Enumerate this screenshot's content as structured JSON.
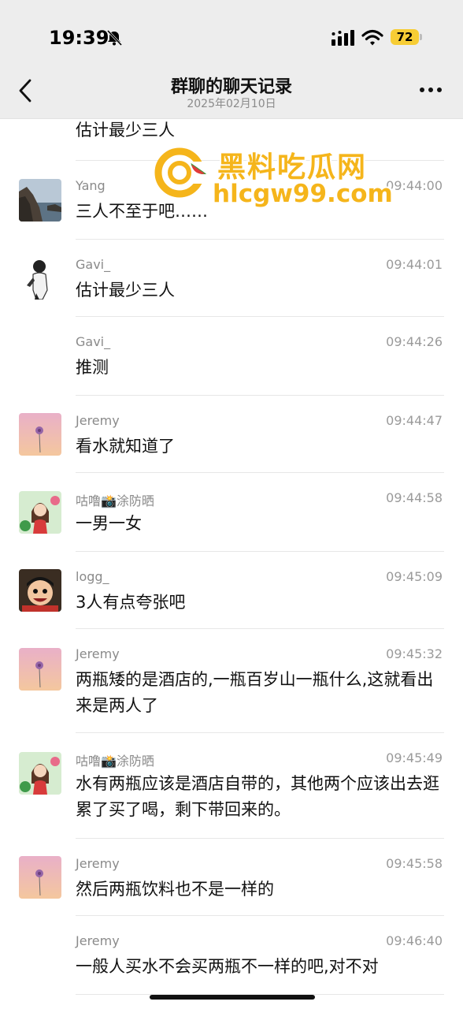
{
  "status_bar": {
    "time": "19:39",
    "battery": "72",
    "muted": true
  },
  "header": {
    "title": "群聊的聊天记录",
    "date": "2025年02月10日",
    "back_icon": "chevron-left-icon",
    "more_icon": "ellipsis-icon"
  },
  "watermark": {
    "title": "黑料吃瓜网",
    "url": "hlcgw99.com",
    "color": "#f5b51b"
  },
  "messages": [
    {
      "text": "估计最少三人"
    },
    {
      "sender": "Yang",
      "time": "09:44:00",
      "text": "三人不至于吧……",
      "avatar": "landscape-avatar"
    },
    {
      "sender": "Gavi_",
      "time": "09:44:01",
      "text": "估计最少三人",
      "avatar": "person-avatar"
    },
    {
      "sender": "Gavi_",
      "time": "09:44:26",
      "text": "推测"
    },
    {
      "sender": "Jeremy",
      "time": "09:44:47",
      "text": "看水就知道了",
      "avatar": "flower-avatar"
    },
    {
      "sender": "咕噜📸涂防晒",
      "time": "09:44:58",
      "text": "一男一女",
      "avatar": "girl-avatar"
    },
    {
      "sender": "logg_",
      "time": "09:45:09",
      "text": "3人有点夸张吧",
      "avatar": "cartoon-avatar"
    },
    {
      "sender": "Jeremy",
      "time": "09:45:32",
      "text": "两瓶矮的是酒店的,一瓶百岁山一瓶什么,这就看出来是两人了",
      "avatar": "flower-avatar"
    },
    {
      "sender": "咕噜📸涂防晒",
      "time": "09:45:49",
      "text": "水有两瓶应该是酒店自带的，其他两个应该出去逛累了买了喝，剩下带回来的。",
      "avatar": "girl-avatar"
    },
    {
      "sender": "Jeremy",
      "time": "09:45:58",
      "text": "然后两瓶饮料也不是一样的",
      "avatar": "flower-avatar"
    },
    {
      "sender": "Jeremy",
      "time": "09:46:40",
      "text": "一般人买水不会买两瓶不一样的吧,对不对"
    }
  ]
}
